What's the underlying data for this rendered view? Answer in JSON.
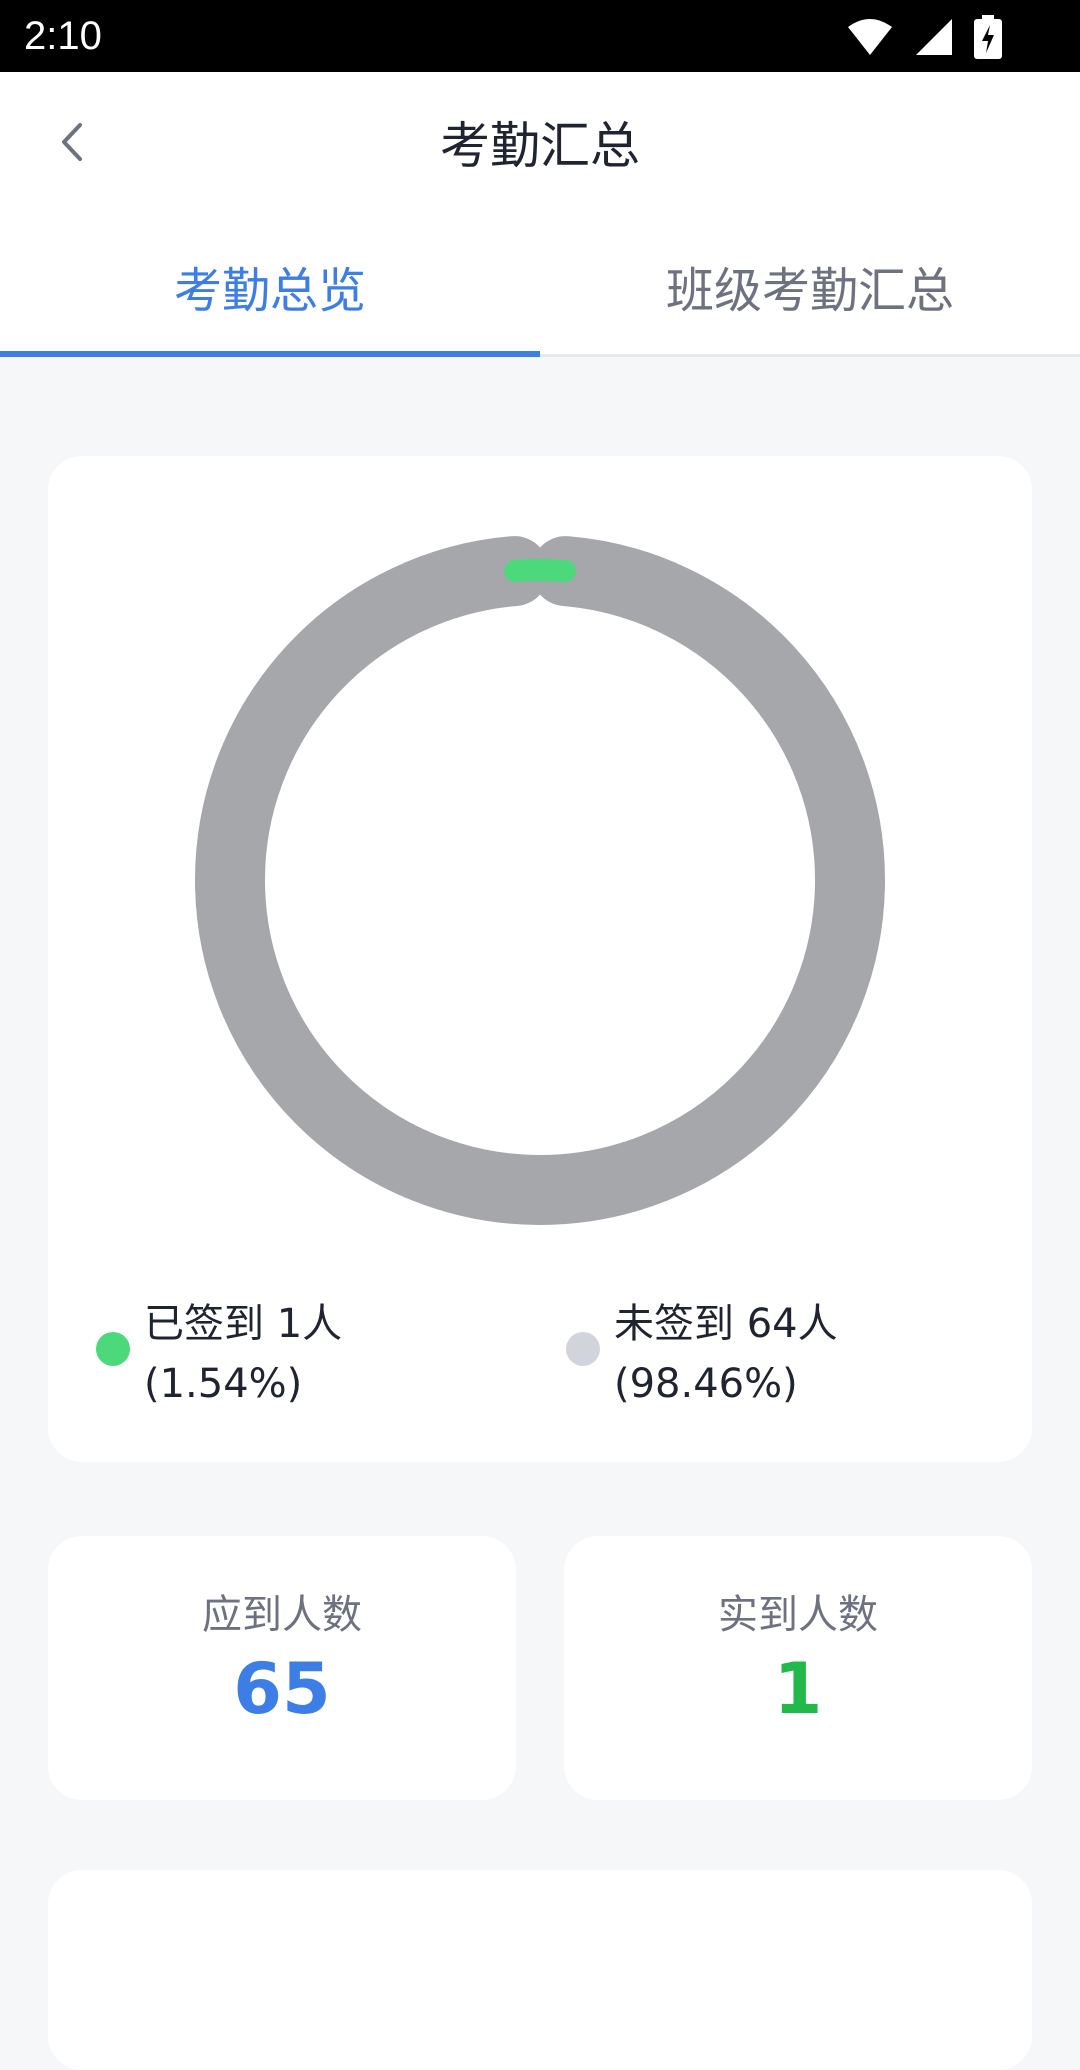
{
  "status_bar": {
    "time": "2:10",
    "icons": [
      "wifi-icon",
      "signal-icon",
      "battery-charging-icon"
    ]
  },
  "header": {
    "title": "考勤汇总",
    "back_icon": "chevron-left-icon"
  },
  "tabs": [
    {
      "label": "考勤总览",
      "active": true
    },
    {
      "label": "班级考勤汇总",
      "active": false
    }
  ],
  "colors": {
    "accent": "#3d7ee6",
    "signed": "#4cd97b",
    "unsigned_ring": "#a6a7aa",
    "unsigned_dot": "#d1d4db",
    "success_text": "#22b84a"
  },
  "chart_data": {
    "type": "pie",
    "slices": [
      {
        "label": "已签到",
        "count": 1,
        "percent": 1.54,
        "color": "#4cd97b"
      },
      {
        "label": "未签到",
        "count": 64,
        "percent": 98.46,
        "color": "#a6a7aa"
      }
    ]
  },
  "legend": [
    {
      "line1": "已签到 1人",
      "line2": "(1.54%)"
    },
    {
      "line1": "未签到 64人",
      "line2": "(98.46%)"
    }
  ],
  "stats": {
    "expected_label": "应到人数",
    "expected_value": "65",
    "actual_label": "实到人数",
    "actual_value": "1"
  }
}
